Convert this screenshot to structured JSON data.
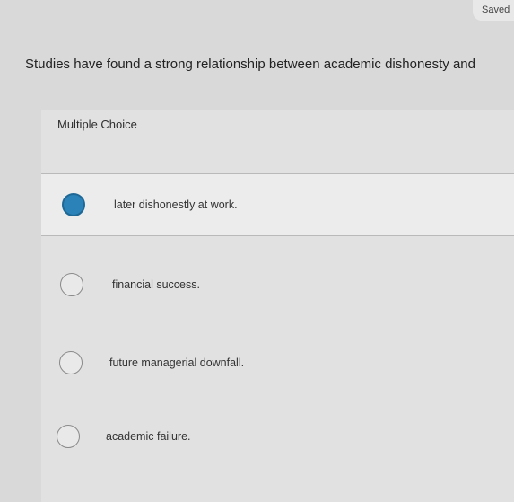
{
  "header": {
    "saved_label": "Saved"
  },
  "question": {
    "text": "Studies have found a strong relationship between academic dishonesty and"
  },
  "question_type": "Multiple Choice",
  "choices": [
    {
      "label": "later dishonestly at work.",
      "selected": true
    },
    {
      "label": "financial success.",
      "selected": false
    },
    {
      "label": "future managerial downfall.",
      "selected": false
    },
    {
      "label": "academic failure.",
      "selected": false
    }
  ],
  "colors": {
    "selected_radio": "#2a82b8",
    "background": "#d9d9d9"
  }
}
